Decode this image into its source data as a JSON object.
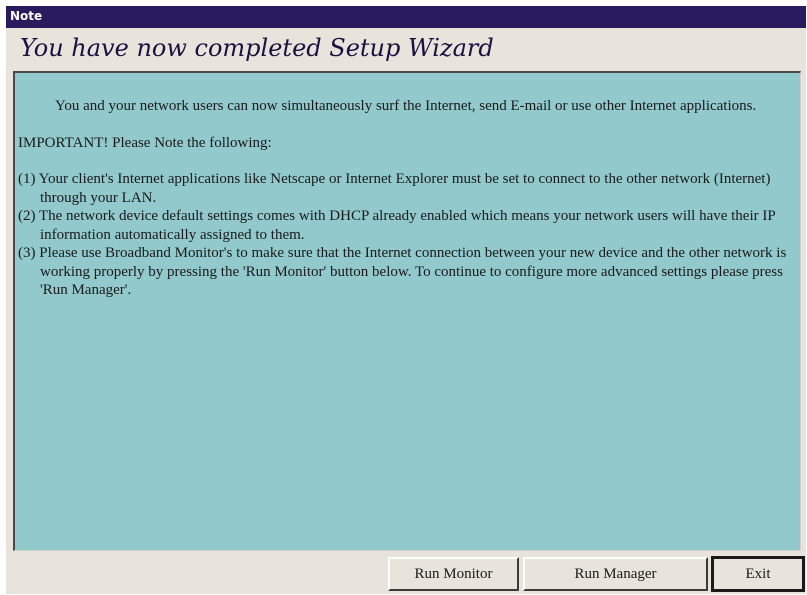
{
  "window": {
    "title": "Note"
  },
  "heading": "You have now completed Setup Wizard",
  "content": {
    "intro": "You and your network users can now simultaneously surf the Internet, send E-mail or use other Internet applications.",
    "important": "IMPORTANT! Please Note the following:",
    "items": [
      "(1) Your client's Internet applications like Netscape or Internet Explorer must be set to connect to the other network (Internet) through your LAN.",
      "(2) The network device default settings comes with DHCP already enabled which means your network users will have their IP information automatically assigned to them.",
      "(3) Please use Broadband Monitor's to make sure that the Internet connection between your new device and the other network is working properly by pressing the 'Run Monitor' button below. To continue to configure more advanced settings please press 'Run Manager'."
    ]
  },
  "buttons": {
    "run_monitor": "Run Monitor",
    "run_manager": "Run Manager",
    "exit": "Exit"
  },
  "colors": {
    "titlebar": "#2a1a5e",
    "content_bg": "#92c9cc",
    "window_bg": "#e8e4dc"
  }
}
